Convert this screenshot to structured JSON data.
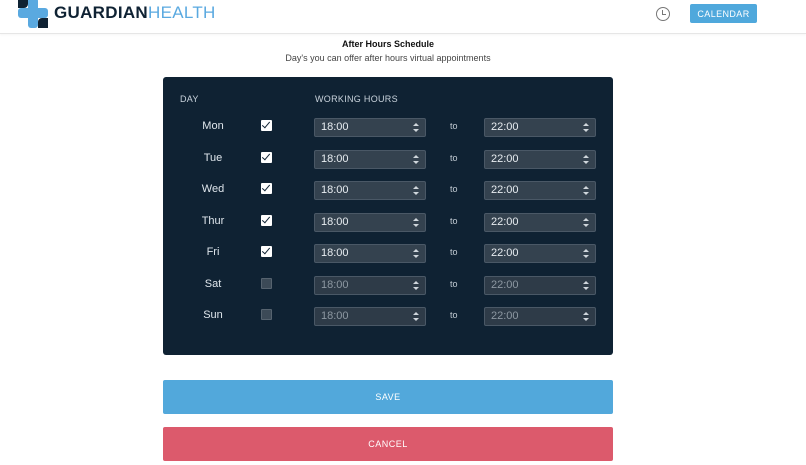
{
  "header": {
    "brand_bold": "GUARDIAN",
    "brand_light": "HEALTH",
    "calendar_label": "CALENDAR"
  },
  "schedule": {
    "title": "After Hours Schedule",
    "subtitle": "Day's you can offer after hours virtual appointments",
    "col_day": "DAY",
    "col_hours": "WORKING HOURS",
    "separator": "to",
    "rows": [
      {
        "day": "Mon",
        "checked": true,
        "from": "18:00",
        "to": "22:00"
      },
      {
        "day": "Tue",
        "checked": true,
        "from": "18:00",
        "to": "22:00"
      },
      {
        "day": "Wed",
        "checked": true,
        "from": "18:00",
        "to": "22:00"
      },
      {
        "day": "Thur",
        "checked": true,
        "from": "18:00",
        "to": "22:00"
      },
      {
        "day": "Fri",
        "checked": true,
        "from": "18:00",
        "to": "22:00"
      },
      {
        "day": "Sat",
        "checked": false,
        "from": "18:00",
        "to": "22:00"
      },
      {
        "day": "Sun",
        "checked": false,
        "from": "18:00",
        "to": "22:00"
      }
    ]
  },
  "actions": {
    "save_label": "SAVE",
    "cancel_label": "CANCEL"
  },
  "colors": {
    "panel": "#0f2233",
    "accent": "#52a8db",
    "danger": "#dc5a6c"
  }
}
